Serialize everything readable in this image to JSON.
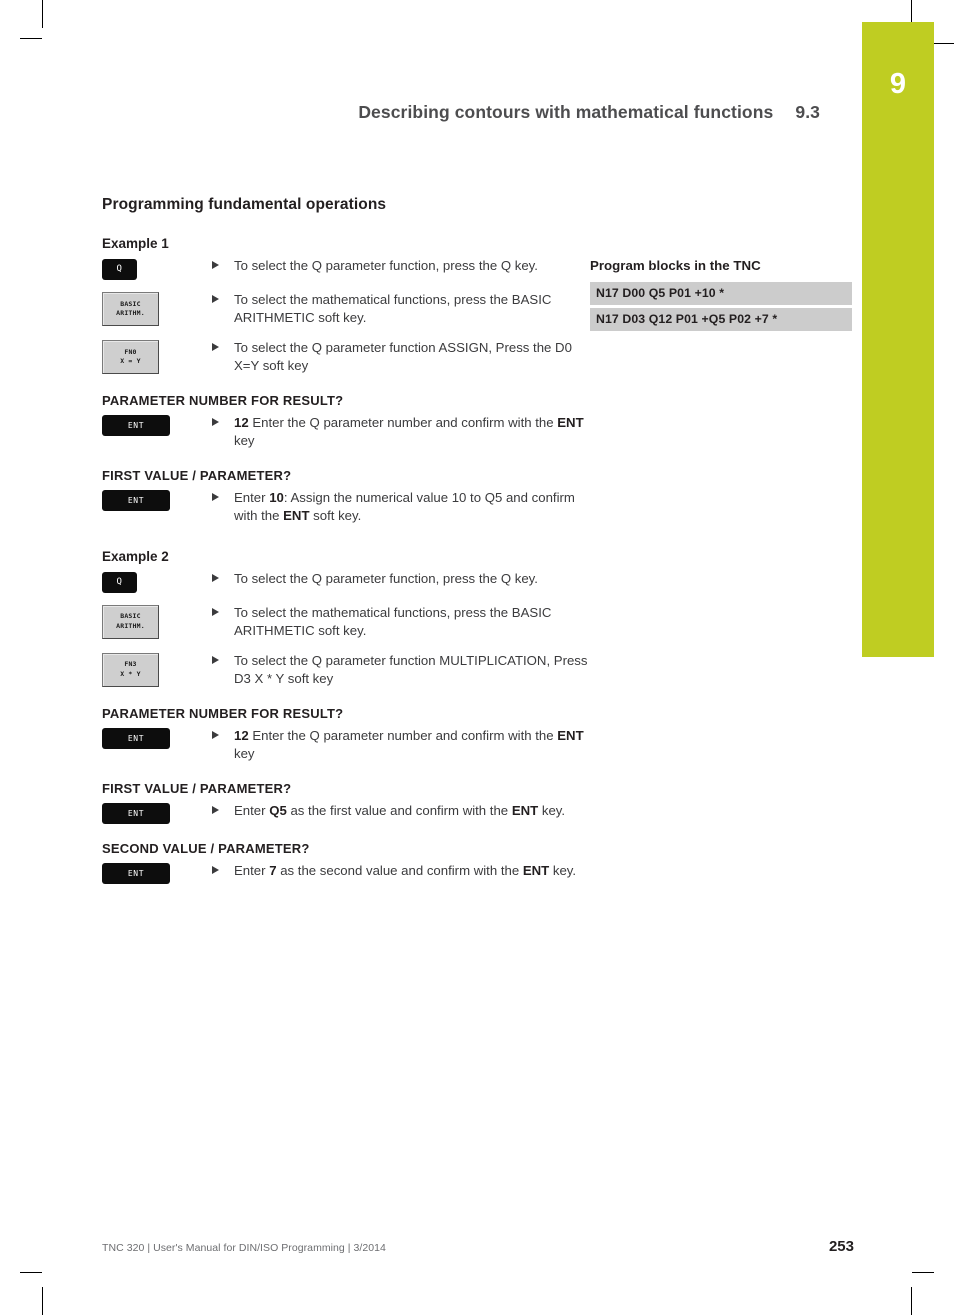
{
  "page": {
    "chapter_number": "9",
    "running_head_title": "Describing contours with mathematical functions",
    "running_head_section": "9.3",
    "section_title": "Programming fundamental operations",
    "accent_color": "#bfcd22",
    "block_bg_color": "#cccccc"
  },
  "examples": [
    {
      "label": "Example 1",
      "steps": [
        {
          "key_type": "hardkey",
          "key_label": "Q",
          "text": "To select the Q parameter function, press the Q key."
        },
        {
          "key_type": "softkey",
          "key_line1": "BASIC",
          "key_line2": "ARITHM.",
          "text": "To select the mathematical functions, press the BASIC ARITHMETIC soft key."
        },
        {
          "key_type": "softkey",
          "key_line1": "FN0",
          "key_line2": "X = Y",
          "text": "To select the Q parameter function ASSIGN, Press the D0 X=Y soft key"
        }
      ],
      "dialogs": [
        {
          "prompt": "PARAMETER NUMBER FOR RESULT?",
          "key_label": "ENT",
          "text_parts": [
            {
              "bold": true,
              "text": "12"
            },
            {
              "bold": false,
              "text": " Enter the Q parameter number and confirm with the "
            },
            {
              "bold": true,
              "text": "ENT"
            },
            {
              "bold": false,
              "text": " key"
            }
          ]
        },
        {
          "prompt": "FIRST VALUE / PARAMETER?",
          "key_label": "ENT",
          "text_parts": [
            {
              "bold": false,
              "text": "Enter "
            },
            {
              "bold": true,
              "text": "10"
            },
            {
              "bold": false,
              "text": ": Assign the numerical value 10 to Q5 and confirm with the "
            },
            {
              "bold": true,
              "text": "ENT"
            },
            {
              "bold": false,
              "text": " soft key."
            }
          ]
        }
      ]
    },
    {
      "label": "Example 2",
      "steps": [
        {
          "key_type": "hardkey",
          "key_label": "Q",
          "text": "To select the Q parameter function, press the Q key."
        },
        {
          "key_type": "softkey",
          "key_line1": "BASIC",
          "key_line2": "ARITHM.",
          "text": "To select the mathematical functions, press the BASIC ARITHMETIC soft key."
        },
        {
          "key_type": "softkey",
          "key_line1": "FN3",
          "key_line2": "X * Y",
          "text": "To select the Q parameter function MULTIPLICATION, Press D3 X * Y soft key"
        }
      ],
      "dialogs": [
        {
          "prompt": "PARAMETER NUMBER FOR RESULT?",
          "key_label": "ENT",
          "text_parts": [
            {
              "bold": true,
              "text": "12"
            },
            {
              "bold": false,
              "text": " Enter the Q parameter number and confirm with the "
            },
            {
              "bold": true,
              "text": "ENT"
            },
            {
              "bold": false,
              "text": " key"
            }
          ]
        },
        {
          "prompt": "FIRST VALUE / PARAMETER?",
          "key_label": "ENT",
          "text_parts": [
            {
              "bold": false,
              "text": "Enter "
            },
            {
              "bold": true,
              "text": "Q5"
            },
            {
              "bold": false,
              "text": " as the first value and confirm with the "
            },
            {
              "bold": true,
              "text": "ENT"
            },
            {
              "bold": false,
              "text": " key."
            }
          ]
        },
        {
          "prompt": "SECOND VALUE / PARAMETER?",
          "key_label": "ENT",
          "text_parts": [
            {
              "bold": false,
              "text": "Enter "
            },
            {
              "bold": true,
              "text": "7"
            },
            {
              "bold": false,
              "text": " as the second value and confirm with the "
            },
            {
              "bold": true,
              "text": "ENT"
            },
            {
              "bold": false,
              "text": " key."
            }
          ]
        }
      ]
    }
  ],
  "program_blocks": {
    "title": "Program blocks in the TNC",
    "blocks": [
      "N17 D00 Q5 P01 +10 *",
      "N17 D03 Q12 P01 +Q5 P02 +7 *"
    ]
  },
  "footer": {
    "text": "TNC 320 | User's Manual for DIN/ISO Programming | 3/2014",
    "page_number": "253"
  }
}
